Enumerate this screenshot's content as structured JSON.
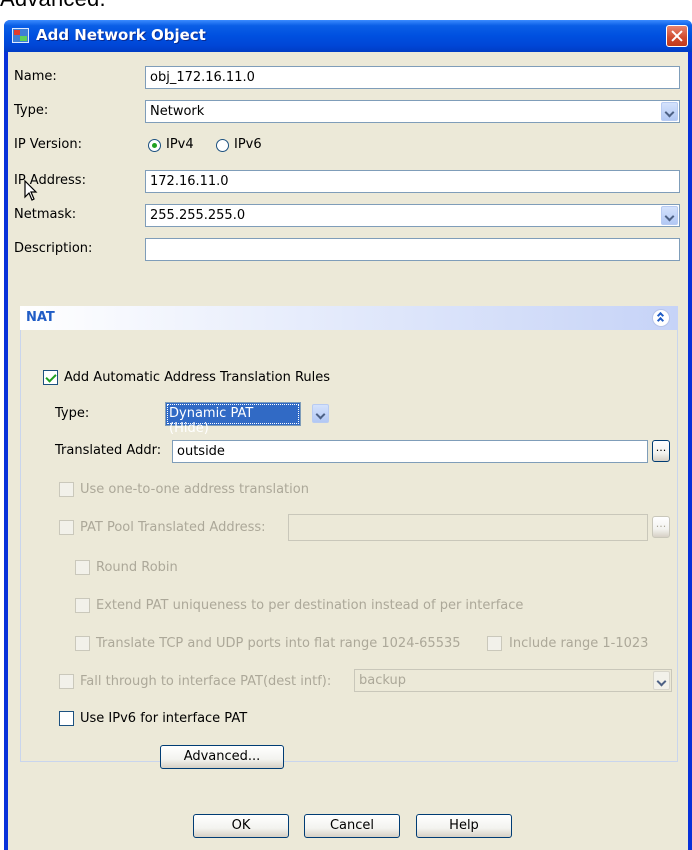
{
  "background_text": "Advanced.",
  "window": {
    "title": "Add Network Object",
    "close_label": "×"
  },
  "form": {
    "name_label": "Name:",
    "name_value": "obj_172.16.11.0",
    "type_label": "Type:",
    "type_value": "Network",
    "ip_version_label": "IP Version:",
    "ipv4_label": "IPv4",
    "ipv6_label": "IPv6",
    "ip_version_selected": "IPv4",
    "ip_address_label": "IP Address:",
    "ip_address_value": "172.16.11.0",
    "netmask_label": "Netmask:",
    "netmask_value": "255.255.255.0",
    "description_label": "Description:",
    "description_value": ""
  },
  "nat": {
    "header": "NAT",
    "auto_rules_label": "Add Automatic Address Translation Rules",
    "auto_rules_checked": true,
    "type_label": "Type:",
    "type_value": "Dynamic PAT (Hide)",
    "translated_addr_label": "Translated Addr:",
    "translated_addr_value": "outside",
    "browse_label": "...",
    "one_to_one_label": "Use one-to-one address translation",
    "pat_pool_label": "PAT Pool Translated Address:",
    "pat_pool_value": "",
    "round_robin_label": "Round Robin",
    "extend_pat_label": "Extend PAT uniqueness to per destination instead of per interface",
    "translate_tcp_label": "Translate TCP and UDP ports into flat range 1024-65535",
    "include_range_label": "Include range 1-1023",
    "fall_through_label": "Fall through to interface PAT(dest intf):",
    "fall_through_value": "backup",
    "use_ipv6_label": "Use IPv6 for interface PAT",
    "advanced_label": "Advanced..."
  },
  "buttons": {
    "ok": "OK",
    "cancel": "Cancel",
    "help": "Help"
  },
  "colors": {
    "titlebar": "#0050e0",
    "dialog_bg": "#ece9d8",
    "nat_header_text": "#215dc6",
    "selection": "#316ac5",
    "check_green": "#21a121"
  }
}
